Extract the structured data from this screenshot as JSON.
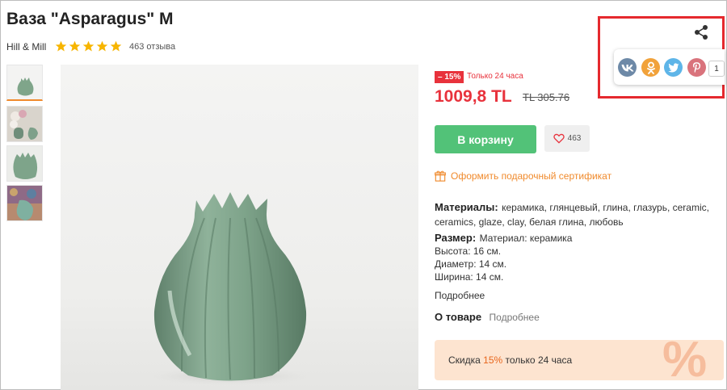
{
  "product": {
    "title": "Ваза \"Asparagus\" M",
    "brand": "Hill & Mill",
    "rating_stars": 5,
    "reviews": "463 отзыва"
  },
  "pricing": {
    "discount_badge": "– 15%",
    "limited_text": "Только 24 часа",
    "price": "1009,8 TL",
    "old_price": "TL 305.76"
  },
  "actions": {
    "cart_label": "В корзину",
    "favorites_count": "463",
    "gift_label": "Оформить подарочный сертификат"
  },
  "attributes": {
    "materials_label": "Материалы:",
    "materials_value": "керамика, глянцевый, глина, глазурь, ceramic, ceramics, glaze, clay, белая глина, любовь",
    "size_label": "Размер:",
    "size_material": "Материал: керамика",
    "height": "Высота: 16 см.",
    "diameter": "Диаметр: 14 см.",
    "width": "Ширина: 14 см.",
    "more_label": "Подробнее"
  },
  "about": {
    "label": "О товаре",
    "more_label": "Подробнее"
  },
  "promo": {
    "text_before": "Скидка ",
    "pct": "15%",
    "text_after": " только 24 часа",
    "big_symbol": "%"
  },
  "share": {
    "count": "1",
    "networks": [
      "vk-icon",
      "odnoklassniki-icon",
      "twitter-icon",
      "pinterest-icon"
    ]
  },
  "colors": {
    "accent_red": "#e8323c",
    "cart_green": "#52c278",
    "gift_orange": "#f08a2c",
    "star_yellow": "#f7b500",
    "highlight_box": "#e5292e"
  }
}
